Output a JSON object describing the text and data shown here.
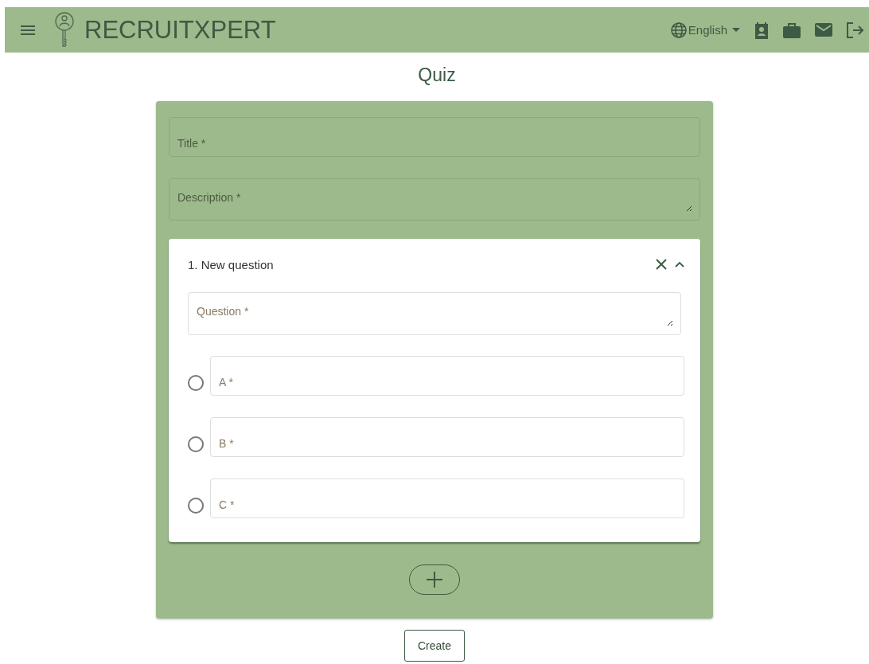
{
  "header": {
    "brand": "RECRUITXPERT",
    "language": "English"
  },
  "page_title": "Quiz",
  "form": {
    "title_field": {
      "placeholder": "Title *"
    },
    "description_field": {
      "placeholder": "Description *"
    },
    "questions": [
      {
        "heading": "1. New question",
        "expanded": true,
        "question_field": {
          "placeholder": "Question *"
        },
        "options": [
          {
            "placeholder": "A *",
            "selected": false
          },
          {
            "placeholder": "B *",
            "selected": false
          },
          {
            "placeholder": "C *",
            "selected": false
          }
        ]
      }
    ]
  },
  "create_button": "Create"
}
